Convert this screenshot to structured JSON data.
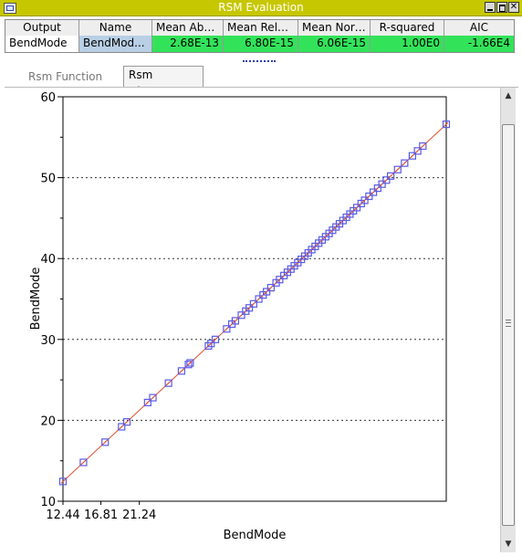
{
  "window": {
    "title": "RSM Evaluation"
  },
  "table": {
    "headers": [
      "Output",
      "Name",
      "Mean Absol...",
      "Mean Relativ...",
      "Mean Norm...",
      "R-squared",
      "AIC"
    ],
    "row": {
      "output": "BendMode",
      "name": "BendMod...",
      "mean_absolute": "2.68E-13",
      "mean_relative": "6.80E-15",
      "mean_normalized": "6.06E-15",
      "r_squared": "1.00E0",
      "aic": "-1.66E4"
    },
    "metric_color": "#32e35a"
  },
  "tabs": [
    {
      "label": "Rsm Function Plot",
      "active": false
    },
    {
      "label": "Rsm Distance",
      "active": true
    }
  ],
  "chart_data": {
    "type": "scatter",
    "xlabel": "BendMode",
    "ylabel": "BendMode",
    "xlim": [
      12.44,
      56.6
    ],
    "ylim": [
      10,
      60
    ],
    "x_tick_labels": [
      "12.44",
      "16.81",
      "21.24"
    ],
    "y_ticks": [
      10,
      20,
      30,
      40,
      50,
      60
    ],
    "grid": "horizontal-dotted",
    "reference_line": {
      "from": [
        12.44,
        12.44
      ],
      "to": [
        56.6,
        56.6
      ],
      "color": "#e0502a"
    },
    "marker_color": "#5a5ae6",
    "series": [
      {
        "x": [
          12.44,
          14.8,
          17.3,
          19.2,
          19.8,
          22.2,
          22.8,
          24.6,
          26.1,
          26.9,
          27.1,
          29.2,
          29.5,
          30.0,
          31.3,
          31.9,
          32.3,
          33.0,
          33.5,
          33.9,
          34.4,
          35.0,
          35.5,
          35.9,
          36.4,
          37.0,
          37.4,
          37.9,
          38.3,
          38.7,
          39.1,
          39.5,
          39.9,
          40.3,
          40.7,
          41.1,
          41.5,
          41.9,
          42.3,
          42.7,
          43.1,
          43.5,
          43.9,
          44.3,
          44.7,
          45.1,
          45.5,
          45.9,
          46.3,
          46.8,
          47.2,
          47.7,
          48.2,
          48.7,
          49.2,
          49.7,
          50.2,
          51.0,
          51.8,
          52.7,
          53.3,
          53.9,
          56.6
        ],
        "y": [
          12.44,
          14.8,
          17.3,
          19.2,
          19.8,
          22.2,
          22.8,
          24.6,
          26.1,
          26.9,
          27.1,
          29.2,
          29.5,
          30.0,
          31.3,
          31.9,
          32.3,
          33.0,
          33.5,
          33.9,
          34.4,
          35.0,
          35.5,
          35.9,
          36.4,
          37.0,
          37.4,
          37.9,
          38.3,
          38.7,
          39.1,
          39.5,
          39.9,
          40.3,
          40.7,
          41.1,
          41.5,
          41.9,
          42.3,
          42.7,
          43.1,
          43.5,
          43.9,
          44.3,
          44.7,
          45.1,
          45.5,
          45.9,
          46.3,
          46.8,
          47.2,
          47.7,
          48.2,
          48.7,
          49.2,
          49.7,
          50.2,
          51.0,
          51.8,
          52.7,
          53.3,
          53.9,
          56.6
        ]
      }
    ]
  }
}
